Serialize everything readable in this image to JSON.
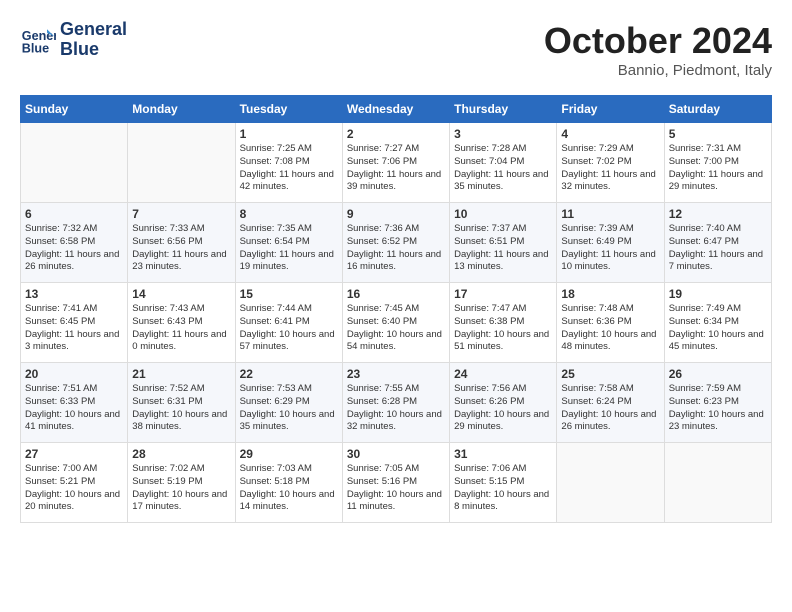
{
  "header": {
    "logo_line1": "General",
    "logo_line2": "Blue",
    "month": "October 2024",
    "location": "Bannio, Piedmont, Italy"
  },
  "days_of_week": [
    "Sunday",
    "Monday",
    "Tuesday",
    "Wednesday",
    "Thursday",
    "Friday",
    "Saturday"
  ],
  "weeks": [
    [
      {
        "num": "",
        "info": ""
      },
      {
        "num": "",
        "info": ""
      },
      {
        "num": "1",
        "info": "Sunrise: 7:25 AM\nSunset: 7:08 PM\nDaylight: 11 hours and 42 minutes."
      },
      {
        "num": "2",
        "info": "Sunrise: 7:27 AM\nSunset: 7:06 PM\nDaylight: 11 hours and 39 minutes."
      },
      {
        "num": "3",
        "info": "Sunrise: 7:28 AM\nSunset: 7:04 PM\nDaylight: 11 hours and 35 minutes."
      },
      {
        "num": "4",
        "info": "Sunrise: 7:29 AM\nSunset: 7:02 PM\nDaylight: 11 hours and 32 minutes."
      },
      {
        "num": "5",
        "info": "Sunrise: 7:31 AM\nSunset: 7:00 PM\nDaylight: 11 hours and 29 minutes."
      }
    ],
    [
      {
        "num": "6",
        "info": "Sunrise: 7:32 AM\nSunset: 6:58 PM\nDaylight: 11 hours and 26 minutes."
      },
      {
        "num": "7",
        "info": "Sunrise: 7:33 AM\nSunset: 6:56 PM\nDaylight: 11 hours and 23 minutes."
      },
      {
        "num": "8",
        "info": "Sunrise: 7:35 AM\nSunset: 6:54 PM\nDaylight: 11 hours and 19 minutes."
      },
      {
        "num": "9",
        "info": "Sunrise: 7:36 AM\nSunset: 6:52 PM\nDaylight: 11 hours and 16 minutes."
      },
      {
        "num": "10",
        "info": "Sunrise: 7:37 AM\nSunset: 6:51 PM\nDaylight: 11 hours and 13 minutes."
      },
      {
        "num": "11",
        "info": "Sunrise: 7:39 AM\nSunset: 6:49 PM\nDaylight: 11 hours and 10 minutes."
      },
      {
        "num": "12",
        "info": "Sunrise: 7:40 AM\nSunset: 6:47 PM\nDaylight: 11 hours and 7 minutes."
      }
    ],
    [
      {
        "num": "13",
        "info": "Sunrise: 7:41 AM\nSunset: 6:45 PM\nDaylight: 11 hours and 3 minutes."
      },
      {
        "num": "14",
        "info": "Sunrise: 7:43 AM\nSunset: 6:43 PM\nDaylight: 11 hours and 0 minutes."
      },
      {
        "num": "15",
        "info": "Sunrise: 7:44 AM\nSunset: 6:41 PM\nDaylight: 10 hours and 57 minutes."
      },
      {
        "num": "16",
        "info": "Sunrise: 7:45 AM\nSunset: 6:40 PM\nDaylight: 10 hours and 54 minutes."
      },
      {
        "num": "17",
        "info": "Sunrise: 7:47 AM\nSunset: 6:38 PM\nDaylight: 10 hours and 51 minutes."
      },
      {
        "num": "18",
        "info": "Sunrise: 7:48 AM\nSunset: 6:36 PM\nDaylight: 10 hours and 48 minutes."
      },
      {
        "num": "19",
        "info": "Sunrise: 7:49 AM\nSunset: 6:34 PM\nDaylight: 10 hours and 45 minutes."
      }
    ],
    [
      {
        "num": "20",
        "info": "Sunrise: 7:51 AM\nSunset: 6:33 PM\nDaylight: 10 hours and 41 minutes."
      },
      {
        "num": "21",
        "info": "Sunrise: 7:52 AM\nSunset: 6:31 PM\nDaylight: 10 hours and 38 minutes."
      },
      {
        "num": "22",
        "info": "Sunrise: 7:53 AM\nSunset: 6:29 PM\nDaylight: 10 hours and 35 minutes."
      },
      {
        "num": "23",
        "info": "Sunrise: 7:55 AM\nSunset: 6:28 PM\nDaylight: 10 hours and 32 minutes."
      },
      {
        "num": "24",
        "info": "Sunrise: 7:56 AM\nSunset: 6:26 PM\nDaylight: 10 hours and 29 minutes."
      },
      {
        "num": "25",
        "info": "Sunrise: 7:58 AM\nSunset: 6:24 PM\nDaylight: 10 hours and 26 minutes."
      },
      {
        "num": "26",
        "info": "Sunrise: 7:59 AM\nSunset: 6:23 PM\nDaylight: 10 hours and 23 minutes."
      }
    ],
    [
      {
        "num": "27",
        "info": "Sunrise: 7:00 AM\nSunset: 5:21 PM\nDaylight: 10 hours and 20 minutes."
      },
      {
        "num": "28",
        "info": "Sunrise: 7:02 AM\nSunset: 5:19 PM\nDaylight: 10 hours and 17 minutes."
      },
      {
        "num": "29",
        "info": "Sunrise: 7:03 AM\nSunset: 5:18 PM\nDaylight: 10 hours and 14 minutes."
      },
      {
        "num": "30",
        "info": "Sunrise: 7:05 AM\nSunset: 5:16 PM\nDaylight: 10 hours and 11 minutes."
      },
      {
        "num": "31",
        "info": "Sunrise: 7:06 AM\nSunset: 5:15 PM\nDaylight: 10 hours and 8 minutes."
      },
      {
        "num": "",
        "info": ""
      },
      {
        "num": "",
        "info": ""
      }
    ]
  ]
}
